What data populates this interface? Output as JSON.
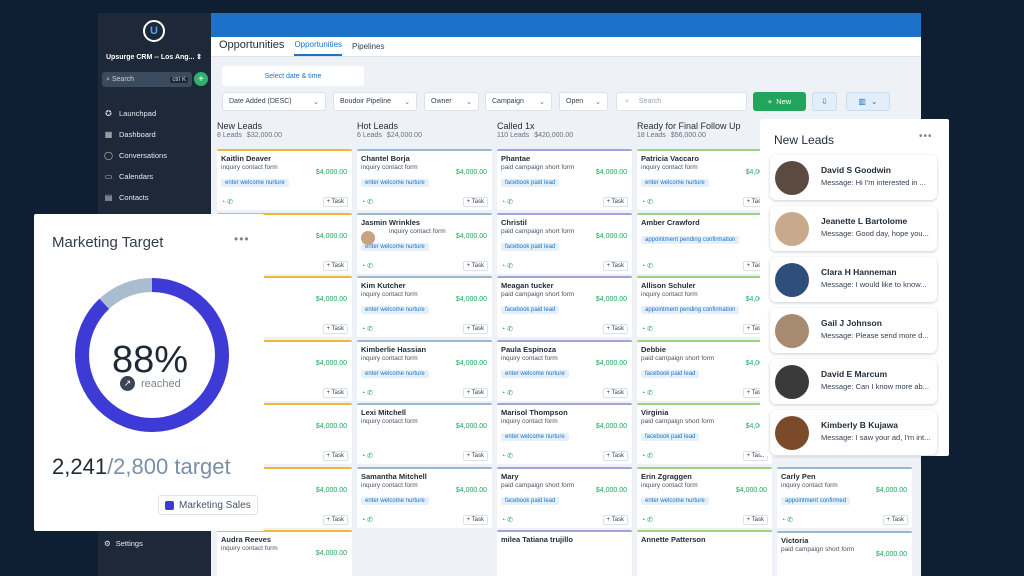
{
  "sidebar": {
    "logo": "U",
    "account": "Upsurge CRM -- Los Ang...",
    "search_placeholder": "Search",
    "search_shortcut": "ctrl K",
    "items": [
      {
        "label": "Launchpad",
        "icon": "rocket-icon"
      },
      {
        "label": "Dashboard",
        "icon": "grid-icon"
      },
      {
        "label": "Conversations",
        "icon": "chat-icon"
      },
      {
        "label": "Calendars",
        "icon": "calendar-icon"
      },
      {
        "label": "Contacts",
        "icon": "contacts-icon"
      }
    ],
    "settings": "Settings"
  },
  "header": {
    "title": "Opportunities",
    "tabs": [
      "Opportunities",
      "Pipelines"
    ],
    "active_tab": "Opportunities"
  },
  "toolbar": {
    "date": "Select date & time",
    "sort": "Date Added (DESC)",
    "pipeline": "Boudoir Pipeline",
    "owner": "Owner",
    "campaign": "Campaign",
    "status": "Open",
    "search_placeholder": "Search",
    "new": "New"
  },
  "columns": [
    {
      "name": "New Leads",
      "count": "8 Leads",
      "amount": "$32,000.00",
      "cards": [
        {
          "name": "Kaitlin Deaver",
          "source": "inquiry contact form",
          "value": "$4,000.00",
          "tag": "enter welcome nurture"
        },
        {
          "name": "",
          "source": "",
          "value": "$4,000.00",
          "tag": "nurture"
        },
        {
          "name": "nson",
          "source": "",
          "value": "$4,000.00",
          "tag": "nurture"
        },
        {
          "name": "",
          "source": "",
          "value": "$4,000.00",
          "tag": "nurture"
        },
        {
          "name": "d",
          "source": "",
          "value": "$4,000.00",
          "tag": "nurture"
        },
        {
          "name": "ttger",
          "source": "",
          "value": "$4,000.00",
          "tag": "nurture"
        },
        {
          "name": "Audra Reeves",
          "source": "inquiry contact form",
          "value": "$4,000.00",
          "tag": ""
        }
      ]
    },
    {
      "name": "Hot Leads",
      "count": "6 Leads",
      "amount": "$24,000.00",
      "cards": [
        {
          "name": "Chantel Borja",
          "source": "inquiry contact form",
          "value": "$4,000.00",
          "tag": "enter welcome nurture"
        },
        {
          "name": "Jasmin Wrinkles",
          "source": "inquiry contact form",
          "value": "$4,000.00",
          "tag": "enter welcome nurture"
        },
        {
          "name": "Kim Kutcher",
          "source": "inquiry contact form",
          "value": "$4,000.00",
          "tag": "enter welcome nurture"
        },
        {
          "name": "Kimberlie Hassian",
          "source": "inquiry contact form",
          "value": "$4,000.00",
          "tag": "enter welcome nurture"
        },
        {
          "name": "Lexi Mitchell",
          "source": "inquiry contact form",
          "value": "$4,000.00",
          "tag": ""
        },
        {
          "name": "Samantha Mitchell",
          "source": "inquiry contact form",
          "value": "$4,000.00",
          "tag": "enter welcome nurture"
        }
      ]
    },
    {
      "name": "Called 1x",
      "count": "110 Leads",
      "amount": "$420,000.00",
      "cards": [
        {
          "name": "Phantae",
          "source": "paid campaign short form",
          "value": "$4,000.00",
          "tag": "facebook paid lead"
        },
        {
          "name": "Christil",
          "source": "paid campaign short form",
          "value": "$4,000.00",
          "tag": "facebook paid lead"
        },
        {
          "name": "Meagan tucker",
          "source": "paid campaign short form",
          "value": "$4,000.00",
          "tag": "facebook paid lead"
        },
        {
          "name": "Paula Espinoza",
          "source": "inquiry contact form",
          "value": "$4,000.00",
          "tag": "enter welcome nurture"
        },
        {
          "name": "Marisol Thompson",
          "source": "inquiry contact form",
          "value": "$4,000.00",
          "tag": "enter welcome nurture"
        },
        {
          "name": "Mary",
          "source": "paid campaign short form",
          "value": "$4,000.00",
          "tag": "facebook paid lead"
        },
        {
          "name": "milea Tatiana trujillo",
          "source": "",
          "value": "",
          "tag": ""
        }
      ]
    },
    {
      "name": "Ready for Final Follow Up",
      "count": "18 Leads",
      "amount": "$56,000.00",
      "cards": [
        {
          "name": "Patricia Vaccaro",
          "source": "inquiry contact form",
          "value": "$4,000",
          "tag": "enter welcome nurture"
        },
        {
          "name": "Amber Crawford",
          "source": "",
          "value": "",
          "tag": "appointment pending confirmation"
        },
        {
          "name": "Allison Schuler",
          "source": "inquiry contact form",
          "value": "$4,000",
          "tag": "appointment pending confirmation"
        },
        {
          "name": "Debbie",
          "source": "paid campaign short form",
          "value": "$4,000",
          "tag": "facebook paid lead"
        },
        {
          "name": "Virginia",
          "source": "paid campaign short form",
          "value": "$4,000",
          "tag": "facebook paid lead"
        },
        {
          "name": "Erin Zgraggen",
          "source": "inquiry contact form",
          "value": "$4,000.00",
          "tag": "enter welcome nurture"
        },
        {
          "name": "Annette Patterson",
          "source": "",
          "value": "",
          "tag": ""
        }
      ]
    },
    {
      "name": "",
      "count": "",
      "amount": "",
      "cards": [
        {
          "name": "Carly Pen",
          "source": "inquiry contact form",
          "value": "$4,000.00",
          "tag": "appointment confirmed"
        },
        {
          "name": "Victoria",
          "source": "paid campaign short form",
          "value": "$4,000.00",
          "tag": ""
        }
      ]
    }
  ],
  "task_label": "+ Task",
  "target": {
    "title": "Marketing Target",
    "percent": "88%",
    "percent_value": 0.88,
    "reached": "reached",
    "current": "2,241",
    "target": "/2,800 target",
    "legend": "Marketing Sales",
    "ring_color": "#3d3ad6",
    "ring_track_color": "#a9bcd0"
  },
  "leads": {
    "title": "New Leads",
    "items": [
      {
        "name": "David S Goodwin",
        "message": "Message: Hi I'm interested in ..."
      },
      {
        "name": "Jeanette L Bartolome",
        "message": "Message: Good day, hope you..."
      },
      {
        "name": "Clara H Hanneman",
        "message": "Message: I would like to know..."
      },
      {
        "name": "Gail J Johnson",
        "message": "Message: Please send more d..."
      },
      {
        "name": "David E Marcum",
        "message": "Message: Can I know more ab..."
      },
      {
        "name": "Kimberly B Kujawa",
        "message": "Message: I saw your ad, I'm int..."
      }
    ]
  },
  "colors": {
    "brand_blue": "#1a73c8",
    "sidebar": "#1d2939",
    "green": "#22a55a",
    "background": "#0f1f33"
  }
}
